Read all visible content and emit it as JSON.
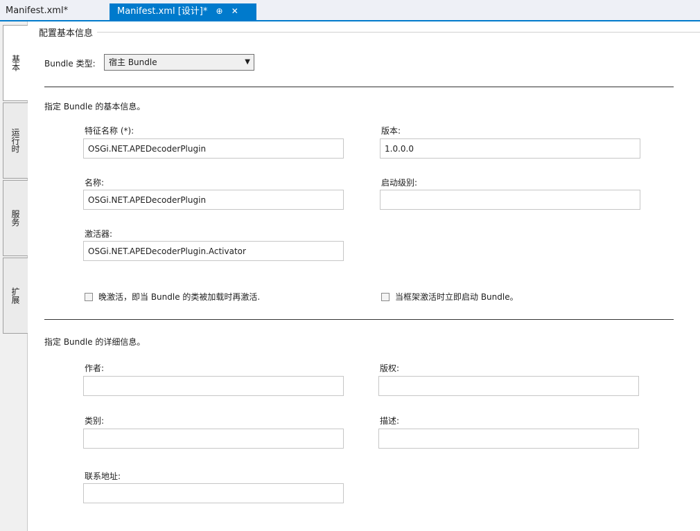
{
  "tabs": {
    "inactive_label": "Manifest.xml*",
    "active_label": "Manifest.xml [设计]*",
    "pin_glyph": "⊕",
    "close_glyph": "✕"
  },
  "side_tabs": [
    "基本",
    "运行时",
    "服务",
    "扩展"
  ],
  "basic": {
    "group_title": "配置基本信息",
    "bundle_type_label": "Bundle 类型:",
    "bundle_type_value": "宿主 Bundle"
  },
  "basic_info": {
    "header": "指定 Bundle 的基本信息。",
    "symbolic_name_label": "特征名称 (*):",
    "symbolic_name_value": "OSGi.NET.APEDecoderPlugin",
    "version_label": "版本:",
    "version_value": "1.0.0.0",
    "name_label": "名称:",
    "name_value": "OSGi.NET.APEDecoderPlugin",
    "start_level_label": "启动级别:",
    "start_level_value": "",
    "activator_label": "激活器:",
    "activator_value": "OSGi.NET.APEDecoderPlugin.Activator",
    "lazy_activation_label": "晚激活，即当 Bundle 的类被加载时再激活.",
    "start_immediately_label": "当框架激活时立即启动 Bundle。"
  },
  "detail_info": {
    "header": "指定 Bundle 的详细信息。",
    "author_label": "作者:",
    "author_value": "",
    "copyright_label": "版权:",
    "copyright_value": "",
    "category_label": "类别:",
    "category_value": "",
    "description_label": "描述:",
    "description_value": "",
    "contact_label": "联系地址:",
    "contact_value": ""
  }
}
